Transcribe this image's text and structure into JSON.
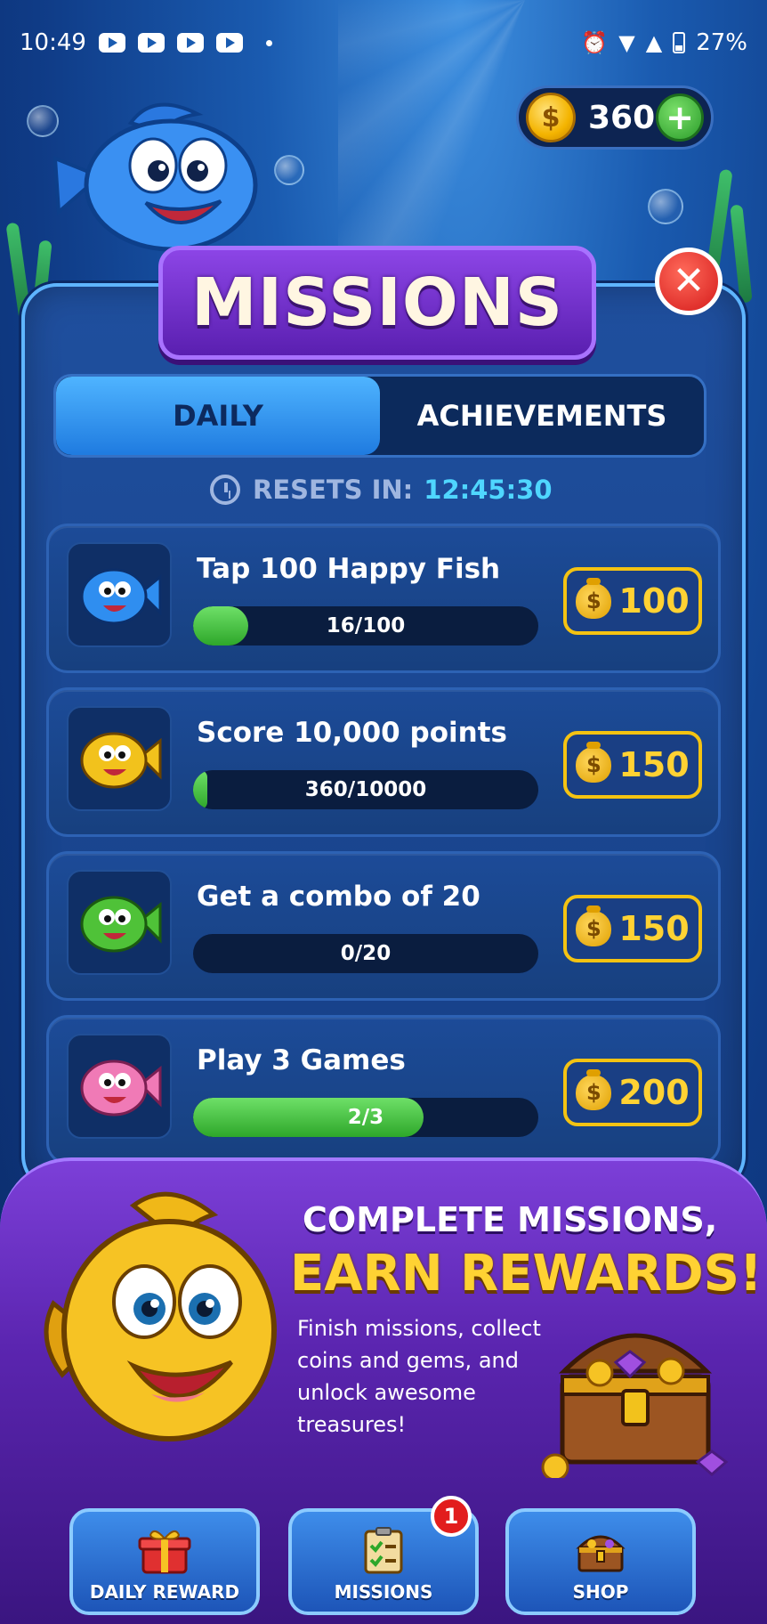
{
  "status_bar": {
    "time": "10:49",
    "battery": "27%"
  },
  "currency": {
    "coins": "360"
  },
  "header": {
    "title": "MISSIONS"
  },
  "tabs": [
    {
      "label": "DAILY",
      "active": true
    },
    {
      "label": "ACHIEVEMENTS",
      "active": false
    }
  ],
  "resets": {
    "label": "RESETS IN:",
    "time": "12:45:30"
  },
  "missions": [
    {
      "title": "Tap 100 Happy Fish",
      "progress_text": "16/100",
      "progress": 0.16,
      "reward": "100",
      "fish_color": "#2f8ef0"
    },
    {
      "title": "Score 10,000 points",
      "progress_text": "360/10000",
      "progress": 0.036,
      "reward": "150",
      "fish_color": "#f2c21c"
    },
    {
      "title": "Get a combo of 20",
      "progress_text": "0/20",
      "progress": 0,
      "reward": "150",
      "fish_color": "#4fc238"
    },
    {
      "title": "Play 3 Games",
      "progress_text": "2/3",
      "progress": 0.667,
      "reward": "200",
      "fish_color": "#f07ab6"
    }
  ],
  "promo": {
    "line1": "COMPLETE MISSIONS,",
    "line2": "EARN REWARDS!",
    "body": "Finish missions, collect coins and gems, and unlock awesome treasures!"
  },
  "nav": [
    {
      "label": "DAILY REWARD",
      "icon": "gift-icon"
    },
    {
      "label": "MISSIONS",
      "icon": "clipboard-icon",
      "badge": "1"
    },
    {
      "label": "SHOP",
      "icon": "treasure-chest-icon"
    }
  ],
  "colors": {
    "accent": "#4fd6ff",
    "gold": "#ffd233",
    "panel_border": "#5fb5ff",
    "promo_purple": "#5b25b0"
  }
}
